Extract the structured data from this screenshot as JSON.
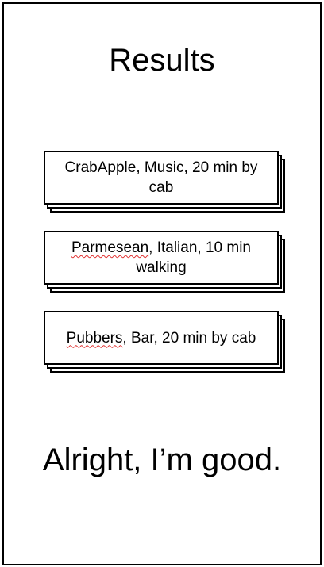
{
  "page": {
    "title": "Results"
  },
  "results": [
    {
      "name": "CrabApple",
      "rest": ", Music, 20 min by cab",
      "flagged": false
    },
    {
      "name": "Parmesean",
      "rest": ", Italian, 10 min walking",
      "flagged": true
    },
    {
      "name": "Pubbers",
      "rest": ", Bar, 20 min by cab",
      "flagged": true
    }
  ],
  "footer": {
    "confirm_label": "Alright, I’m good."
  }
}
